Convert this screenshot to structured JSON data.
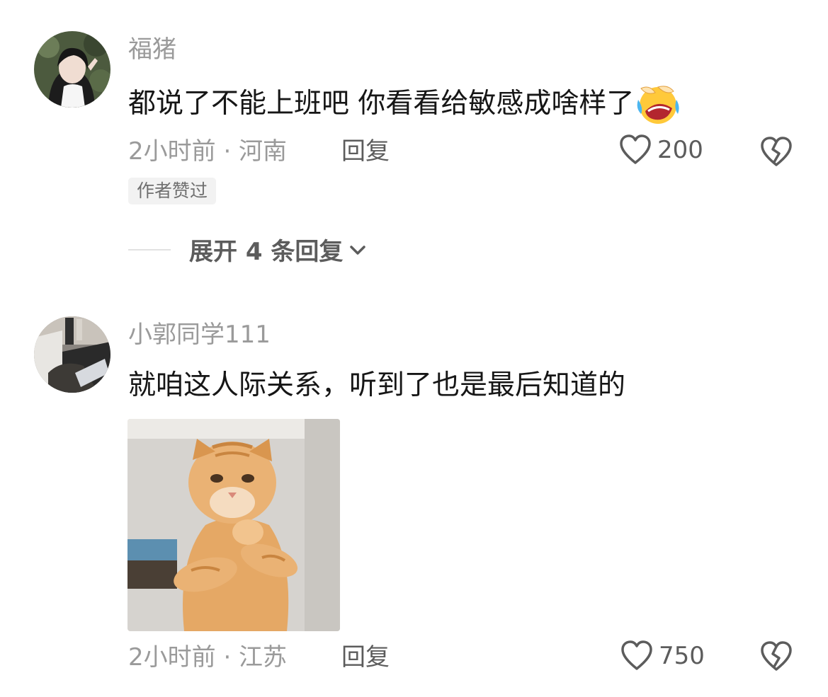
{
  "comments": [
    {
      "username": "福猪",
      "text": "都说了不能上班吧 你看看给敏感成啥样了",
      "emoji": "laughing-crying-emoji",
      "meta": "2小时前 · 河南",
      "reply_label": "回复",
      "likes": "200",
      "badge": "作者赞过",
      "expand_label": "展开 4 条回复",
      "avatar": "girl-portrait-avatar"
    },
    {
      "username": "小郭同学111",
      "text": "就咱这人际关系，听到了也是最后知道的",
      "sticker": "orange-cat-sticker",
      "meta": "2小时前 · 江苏",
      "reply_label": "回复",
      "likes": "750",
      "avatar": "room-photo-avatar"
    }
  ],
  "colors": {
    "username": "#9a9a9a",
    "content": "#161616",
    "action": "#5c5c5c",
    "badge_bg": "#f2f2f2"
  },
  "icons": [
    "heart-outline-icon",
    "broken-heart-icon",
    "chevron-down-icon"
  ]
}
